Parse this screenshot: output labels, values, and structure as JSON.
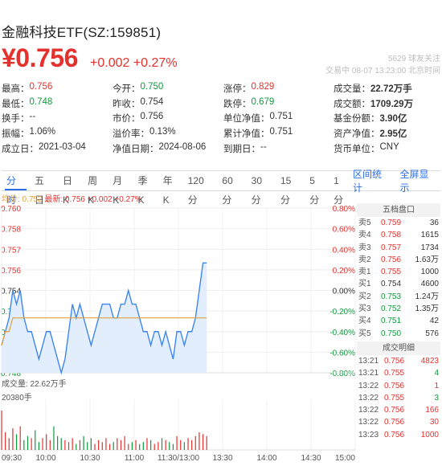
{
  "header": {
    "title": "金融科技ETF(SZ:159851)",
    "price": "¥0.756",
    "change": "+0.002  +0.27%",
    "meta_line1": "5629 球友关注",
    "meta_line2": "交易中 08-07 13:23:00 北京时间"
  },
  "stats": [
    [
      {
        "label": "最高：",
        "value": "0.756",
        "cls": "red"
      },
      {
        "label": "今开：",
        "value": "0.750",
        "cls": "green"
      },
      {
        "label": "涨停：",
        "value": "0.829",
        "cls": "red"
      },
      {
        "label": "成交量：",
        "value": "22.72万手",
        "cls": "bold"
      }
    ],
    [
      {
        "label": "最低：",
        "value": "0.748",
        "cls": "green"
      },
      {
        "label": "昨收：",
        "value": "0.754",
        "cls": ""
      },
      {
        "label": "跌停：",
        "value": "0.679",
        "cls": "green"
      },
      {
        "label": "成交额：",
        "value": "1709.29万",
        "cls": "bold"
      }
    ],
    [
      {
        "label": "换手：",
        "value": "--",
        "cls": ""
      },
      {
        "label": "市价：",
        "value": "0.756",
        "cls": ""
      },
      {
        "label": "单位净值：",
        "value": "0.751",
        "cls": ""
      },
      {
        "label": "基金份额：",
        "value": "3.90亿",
        "cls": "bold"
      }
    ],
    [
      {
        "label": "振幅：",
        "value": "1.06%",
        "cls": ""
      },
      {
        "label": "溢价率：",
        "value": "0.13%",
        "cls": ""
      },
      {
        "label": "累计净值：",
        "value": "0.751",
        "cls": ""
      },
      {
        "label": "资产净值：",
        "value": "2.95亿",
        "cls": "bold"
      }
    ],
    [
      {
        "label": "成立日：",
        "value": "2021-03-04",
        "cls": ""
      },
      {
        "label": "净值日期：",
        "value": "2024-08-06",
        "cls": ""
      },
      {
        "label": "到期日：",
        "value": "--",
        "cls": ""
      },
      {
        "label": "货币单位：",
        "value": "CNY",
        "cls": ""
      }
    ]
  ],
  "tabs": [
    "分时",
    "五日",
    "日K",
    "周K",
    "月K",
    "季K",
    "年K",
    "120分",
    "60分",
    "30分",
    "15分",
    "5分",
    "1分"
  ],
  "active_tab": 0,
  "tabs_right": [
    "区间统计",
    "全屏显示"
  ],
  "legend": {
    "avg": "均价: 0.752",
    "latest": "最新: 0.756 +0.002 +0.27%"
  },
  "volume_label": "成交量: 22.62万手",
  "volume_max_label": "20380手",
  "chart_data": {
    "type": "line",
    "ylim": [
      0.748,
      0.76
    ],
    "y_ticks": [
      "0.760",
      "0.758",
      "0.757",
      "0.756",
      "0.754",
      "0.752",
      "0.751",
      "0.750",
      "0.748"
    ],
    "pct_ticks": [
      "0.80%",
      "0.60%",
      "0.40%",
      "0.20%",
      "0.00%",
      "-0.20%",
      "-0.40%",
      "-0.60%",
      "-0.80%"
    ],
    "x_ticks": [
      "09:30",
      "10:00",
      "10:30",
      "11:00",
      "11:30/13:00",
      "13:30",
      "14:00",
      "14:30",
      "15:00"
    ],
    "prev_close": 0.754,
    "price": [
      0.75,
      0.751,
      0.752,
      0.754,
      0.753,
      0.754,
      0.752,
      0.751,
      0.751,
      0.75,
      0.749,
      0.75,
      0.751,
      0.751,
      0.75,
      0.749,
      0.748,
      0.749,
      0.751,
      0.753,
      0.752,
      0.753,
      0.752,
      0.751,
      0.75,
      0.751,
      0.752,
      0.753,
      0.753,
      0.753,
      0.752,
      0.752,
      0.753,
      0.753,
      0.754,
      0.753,
      0.753,
      0.752,
      0.751,
      0.751,
      0.75,
      0.751,
      0.751,
      0.75,
      0.751,
      0.75,
      0.749,
      0.751,
      0.751,
      0.75,
      0.751,
      0.751,
      0.752,
      0.754,
      0.756,
      0.756
    ],
    "avg": [
      0.75,
      0.751,
      0.751,
      0.752,
      0.752,
      0.752,
      0.752,
      0.752,
      0.752,
      0.752,
      0.752,
      0.752,
      0.752,
      0.752,
      0.752,
      0.752,
      0.752,
      0.752,
      0.752,
      0.752,
      0.752,
      0.752,
      0.752,
      0.752,
      0.752,
      0.752,
      0.752,
      0.752,
      0.752,
      0.752,
      0.752,
      0.752,
      0.752,
      0.752,
      0.752,
      0.752,
      0.752,
      0.752,
      0.752,
      0.752,
      0.752,
      0.752,
      0.752,
      0.752,
      0.752,
      0.752,
      0.752,
      0.752,
      0.752,
      0.752,
      0.752,
      0.752,
      0.752,
      0.752,
      0.752,
      0.752
    ],
    "volume_relative": [
      1.0,
      0.45,
      0.3,
      0.55,
      0.4,
      0.6,
      0.25,
      0.35,
      0.3,
      0.5,
      0.2,
      0.3,
      0.4,
      0.25,
      0.6,
      0.35,
      0.3,
      0.25,
      0.2,
      0.3,
      0.15,
      0.25,
      0.35,
      0.2,
      0.3,
      0.15,
      0.25,
      0.2,
      0.3,
      0.15,
      0.2,
      0.3,
      0.25,
      0.35,
      0.15,
      0.2,
      0.25,
      0.15,
      0.2,
      0.3,
      0.25,
      0.15,
      0.2,
      0.3,
      0.25,
      0.2,
      0.15,
      0.35,
      0.25,
      0.2,
      0.3,
      0.25,
      0.35,
      0.45,
      0.4,
      0.35
    ],
    "session_progress": 0.58,
    "colors": {
      "price": "#3d86f0",
      "avg": "#e0a13c",
      "up": "#e5312d",
      "down": "#0e9a3c",
      "fill": "#e3eefc"
    }
  },
  "orderbook": {
    "title": "五档盘口",
    "rows": [
      {
        "k": "卖5",
        "p": "0.759",
        "v": "36",
        "cls": "red"
      },
      {
        "k": "卖4",
        "p": "0.758",
        "v": "1615",
        "cls": "red"
      },
      {
        "k": "卖3",
        "p": "0.757",
        "v": "1734",
        "cls": "red"
      },
      {
        "k": "卖2",
        "p": "0.756",
        "v": "1.63万",
        "cls": "red"
      },
      {
        "k": "卖1",
        "p": "0.755",
        "v": "1000",
        "cls": "red"
      },
      {
        "k": "买1",
        "p": "0.754",
        "v": "4600",
        "cls": ""
      },
      {
        "k": "买2",
        "p": "0.753",
        "v": "1.24万",
        "cls": "green"
      },
      {
        "k": "买3",
        "p": "0.752",
        "v": "1.35万",
        "cls": "green"
      },
      {
        "k": "买4",
        "p": "0.751",
        "v": "42",
        "cls": "green"
      },
      {
        "k": "买5",
        "p": "0.750",
        "v": "576",
        "cls": "green"
      }
    ]
  },
  "trades": {
    "title": "成交明细",
    "rows": [
      {
        "t": "13:21",
        "p": "0.756",
        "v": "4823",
        "vcls": "red"
      },
      {
        "t": "13:21",
        "p": "0.755",
        "v": "4",
        "vcls": "green"
      },
      {
        "t": "13:22",
        "p": "0.756",
        "v": "1",
        "vcls": "red"
      },
      {
        "t": "13:22",
        "p": "0.755",
        "v": "3",
        "vcls": "green"
      },
      {
        "t": "13:22",
        "p": "0.756",
        "v": "166",
        "vcls": "red"
      },
      {
        "t": "13:22",
        "p": "0.756",
        "v": "30",
        "vcls": "red"
      },
      {
        "t": "13:23",
        "p": "0.756",
        "v": "1000",
        "vcls": "red"
      }
    ]
  }
}
